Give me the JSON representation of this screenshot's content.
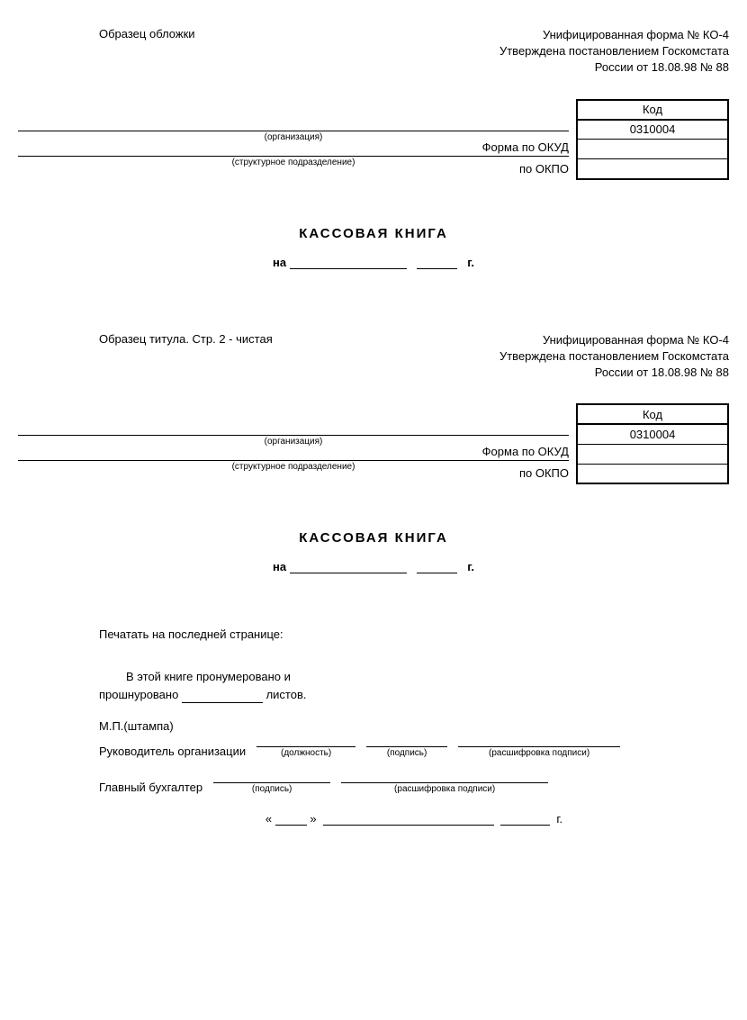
{
  "section1": {
    "left_label": "Образец обложки",
    "form_line": "Унифицированная форма № КО-4",
    "approved_line": "Утверждена постановлением Госкомстата",
    "russia_line": "России от 18.08.98 № 88",
    "code_header": "Код",
    "okud_label": "Форма по ОКУД",
    "okud_value": "0310004",
    "okpo_label": "по ОКПО",
    "org_caption": "(организация)",
    "struct_caption": "(структурное подразделение)",
    "title": "КАССОВАЯ  КНИГА",
    "na": "на",
    "year_suffix": "г."
  },
  "section2": {
    "left_label": "Образец титула. Стр. 2 - чистая",
    "form_line": "Унифицированная форма № КО-4",
    "approved_line": "Утверждена постановлением Госкомстата",
    "russia_line": "России от 18.08.98 № 88",
    "code_header": "Код",
    "okud_label": "Форма по ОКУД",
    "okud_value": "0310004",
    "okpo_label": "по ОКПО",
    "org_caption": "(организация)",
    "struct_caption": "(структурное подразделение)",
    "title": "КАССОВАЯ  КНИГА",
    "na": "на",
    "year_suffix": "г."
  },
  "last_page": {
    "heading": "Печатать на последней странице:",
    "stmt_part1": "В этой книге пронумеровано и",
    "stmt_part2a": "прошнуровано",
    "stmt_part2b": "листов.",
    "mp": "М.П.(штампа)",
    "leader_label": "Руководитель организации",
    "position_cap": "(должность)",
    "signature_cap": "(подпись)",
    "decipher_cap": "(расшифровка подписи)",
    "accountant_label": "Главный бухгалтер",
    "quote_open": "«",
    "quote_close": "»",
    "year_suffix": "г."
  }
}
